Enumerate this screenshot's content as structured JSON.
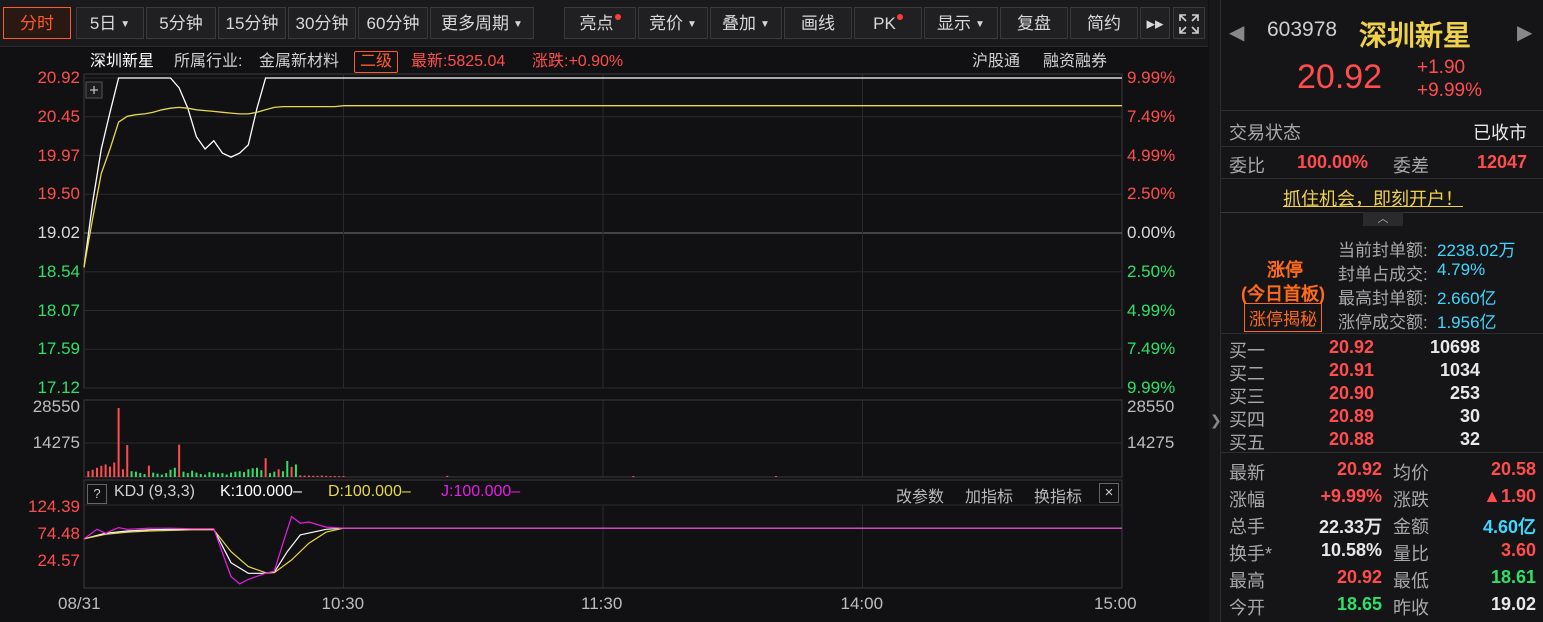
{
  "toolbar": {
    "tabs": [
      "分时",
      "5日",
      "5分钟",
      "15分钟",
      "30分钟",
      "60分钟",
      "更多周期"
    ],
    "tools": [
      "亮点",
      "竞价",
      "叠加",
      "画线",
      "PK",
      "显示",
      "复盘",
      "简约"
    ],
    "more_icon": "double-chevron-right-icon",
    "fullscreen_icon": "fullscreen-icon"
  },
  "info": {
    "name": "深圳新星",
    "industry_label": "所属行业:",
    "industry": "金属新材料",
    "level": "二级",
    "latest": "最新:5825.04",
    "change": "涨跌:+0.90%",
    "link1": "沪股通",
    "link2": "融资融券"
  },
  "kdj": {
    "help": "?",
    "title": "KDJ (9,3,3)",
    "k": "K:100.000–",
    "d": "D:100.000–",
    "j": "J:100.000–",
    "actions": [
      "改参数",
      "加指标",
      "换指标"
    ],
    "close": "×"
  },
  "colors": {
    "up": "#ff4d4d",
    "down": "#2ee06a",
    "price_line": "#ffffff",
    "avg_line": "#e6d84a",
    "kdj_k": "#ffffff",
    "kdj_d": "#e6d84a",
    "kdj_j": "#e61ee6",
    "accent": "#ff5a2a"
  },
  "chart_data": {
    "type": "line",
    "price_ticks": [
      "20.92",
      "20.45",
      "19.97",
      "19.50",
      "19.02",
      "18.54",
      "18.07",
      "17.59",
      "17.12"
    ],
    "pct_ticks": [
      "9.99%",
      "7.49%",
      "4.99%",
      "2.50%",
      "0.00%",
      "2.50%",
      "4.99%",
      "7.49%",
      "9.99%"
    ],
    "ylim": [
      17.12,
      20.92
    ],
    "prev_close": 19.02,
    "x_ticks": [
      "08/31",
      "10:30",
      "11:30",
      "14:00",
      "15:00"
    ],
    "x_tick_minutes": [
      0,
      60,
      120,
      180,
      240
    ],
    "series": [
      {
        "name": "",
        "role": "price",
        "x": [
          0,
          2,
          4,
          6,
          8,
          10,
          12,
          14,
          16,
          18,
          20,
          22,
          24,
          26,
          28,
          30,
          32,
          34,
          36,
          38,
          40,
          42,
          44,
          46,
          48,
          50,
          52,
          54,
          56,
          58,
          60,
          240
        ],
        "values": [
          18.6,
          19.4,
          20.05,
          20.5,
          20.92,
          20.92,
          20.92,
          20.92,
          20.92,
          20.92,
          20.92,
          20.8,
          20.55,
          20.2,
          20.05,
          20.15,
          20.0,
          19.95,
          20.0,
          20.1,
          20.55,
          20.92,
          20.92,
          20.92,
          20.92,
          20.92,
          20.92,
          20.92,
          20.92,
          20.92,
          20.92,
          20.92
        ]
      },
      {
        "name": "",
        "role": "average",
        "x": [
          0,
          2,
          4,
          6,
          8,
          10,
          12,
          14,
          16,
          18,
          20,
          22,
          24,
          26,
          28,
          30,
          32,
          34,
          36,
          38,
          40,
          42,
          44,
          46,
          48,
          50,
          52,
          54,
          56,
          58,
          60,
          120,
          240
        ],
        "values": [
          18.6,
          19.2,
          19.75,
          20.05,
          20.38,
          20.45,
          20.47,
          20.48,
          20.5,
          20.53,
          20.55,
          20.56,
          20.55,
          20.53,
          20.52,
          20.51,
          20.5,
          20.49,
          20.48,
          20.48,
          20.5,
          20.53,
          20.56,
          20.57,
          20.57,
          20.57,
          20.57,
          20.57,
          20.57,
          20.57,
          20.58,
          20.58,
          20.58
        ]
      }
    ],
    "volume": {
      "ticks": [
        "28550",
        "14275"
      ],
      "ylim": [
        0,
        28550
      ],
      "x": [
        1,
        2,
        3,
        4,
        5,
        6,
        7,
        8,
        9,
        10,
        11,
        12,
        13,
        14,
        15,
        16,
        17,
        18,
        19,
        20,
        21,
        22,
        23,
        24,
        25,
        26,
        27,
        28,
        29,
        30,
        31,
        32,
        33,
        34,
        35,
        36,
        37,
        38,
        39,
        40,
        41,
        42,
        43,
        44,
        45,
        46,
        47,
        48,
        49,
        50,
        51,
        52,
        53,
        54,
        55,
        56,
        57,
        58,
        59,
        60,
        84,
        127,
        160
      ],
      "values": [
        2400,
        3000,
        3800,
        4600,
        5200,
        4300,
        6000,
        28550,
        3200,
        13200,
        2400,
        2200,
        1600,
        1200,
        4700,
        1800,
        1400,
        1000,
        1600,
        3000,
        3800,
        13400,
        2200,
        1600,
        2600,
        1800,
        1200,
        1000,
        2000,
        1800,
        1400,
        1600,
        1000,
        1800,
        2200,
        2400,
        2000,
        3200,
        3600,
        3800,
        2800,
        7800,
        1600,
        2200,
        3200,
        2400,
        6600,
        4200,
        5200,
        700,
        600,
        600,
        500,
        500,
        600,
        500,
        400,
        400,
        400,
        400,
        500,
        400,
        400
      ],
      "up": [
        true,
        true,
        true,
        true,
        true,
        true,
        true,
        true,
        true,
        true,
        false,
        false,
        false,
        false,
        true,
        false,
        false,
        false,
        false,
        false,
        false,
        true,
        false,
        false,
        false,
        false,
        false,
        false,
        false,
        false,
        false,
        false,
        false,
        false,
        false,
        false,
        false,
        false,
        false,
        false,
        false,
        true,
        false,
        false,
        true,
        false,
        false,
        true,
        false,
        true,
        true,
        true,
        true,
        true,
        true,
        true,
        true,
        true,
        true,
        true,
        true,
        true,
        true
      ]
    },
    "kdj_axis": {
      "ticks": [
        "124.39",
        "74.48",
        "24.57"
      ],
      "ylim": [
        -5,
        135
      ]
    },
    "kdj_series": [
      {
        "name": "K",
        "x": [
          0,
          5,
          10,
          15,
          20,
          25,
          30,
          34,
          38,
          42,
          44,
          47,
          50,
          56,
          60,
          240
        ],
        "values": [
          78,
          88,
          92,
          94,
          95,
          95,
          95,
          35,
          16,
          16,
          18,
          55,
          85,
          95,
          97,
          97
        ]
      },
      {
        "name": "D",
        "x": [
          0,
          5,
          10,
          15,
          20,
          25,
          30,
          34,
          38,
          42,
          44,
          48,
          52,
          56,
          60,
          240
        ],
        "values": [
          78,
          86,
          90,
          92,
          93,
          94,
          94,
          55,
          28,
          17,
          17,
          40,
          70,
          90,
          97,
          97
        ]
      },
      {
        "name": "J",
        "x": [
          0,
          3,
          5,
          8,
          10,
          15,
          20,
          25,
          30,
          34,
          36,
          38,
          42,
          44,
          46,
          48,
          50,
          52,
          56,
          60,
          240
        ],
        "values": [
          78,
          95,
          88,
          98,
          95,
          97,
          97,
          96,
          96,
          10,
          -3,
          5,
          16,
          20,
          70,
          118,
          106,
          108,
          99,
          97,
          97
        ]
      }
    ]
  },
  "panel": {
    "code": "603978",
    "name": "深圳新星",
    "price": "20.92",
    "change": "+1.90",
    "pct": "+9.99%",
    "trade_status_label": "交易状态",
    "trade_status": "已收市",
    "wb_label": "委比",
    "wb": "100.00%",
    "wc_label": "委差",
    "wc": "12047",
    "promo": "抓住机会，即刻开户！",
    "limit_title": "涨停",
    "limit_sub": "(今日首板)",
    "limit_button": "涨停揭秘",
    "limit_stats": [
      {
        "label": "当前封单额:",
        "value": "2238.02万"
      },
      {
        "label": "封单占成交:",
        "value": "4.79%"
      },
      {
        "label": "最高封单额:",
        "value": "2.660亿"
      },
      {
        "label": "涨停成交额:",
        "value": "1.956亿"
      }
    ],
    "bids": [
      {
        "label": "买一",
        "price": "20.92",
        "vol": "10698"
      },
      {
        "label": "买二",
        "price": "20.91",
        "vol": "1034"
      },
      {
        "label": "买三",
        "price": "20.90",
        "vol": "253"
      },
      {
        "label": "买四",
        "price": "20.89",
        "vol": "30"
      },
      {
        "label": "买五",
        "price": "20.88",
        "vol": "32"
      }
    ],
    "stats": [
      {
        "l1": "最新",
        "v1": "20.92",
        "c1": "red",
        "l2": "均价",
        "v2": "20.58",
        "c2": "red"
      },
      {
        "l1": "涨幅",
        "v1": "+9.99%",
        "c1": "red",
        "l2": "涨跌",
        "v2": "▲1.90",
        "c2": "red"
      },
      {
        "l1": "总手",
        "v1": "22.33万",
        "c1": "white",
        "l2": "金额",
        "v2": "4.60亿",
        "c2": "cyan"
      },
      {
        "l1": "换手*",
        "v1": "10.58%",
        "c1": "white",
        "l2": "量比",
        "v2": "3.60",
        "c2": "red"
      },
      {
        "l1": "最高",
        "v1": "20.92",
        "c1": "red",
        "l2": "最低",
        "v2": "18.61",
        "c2": "green"
      },
      {
        "l1": "今开",
        "v1": "18.65",
        "c1": "green",
        "l2": "昨收",
        "v2": "19.02",
        "c2": "white"
      }
    ]
  }
}
